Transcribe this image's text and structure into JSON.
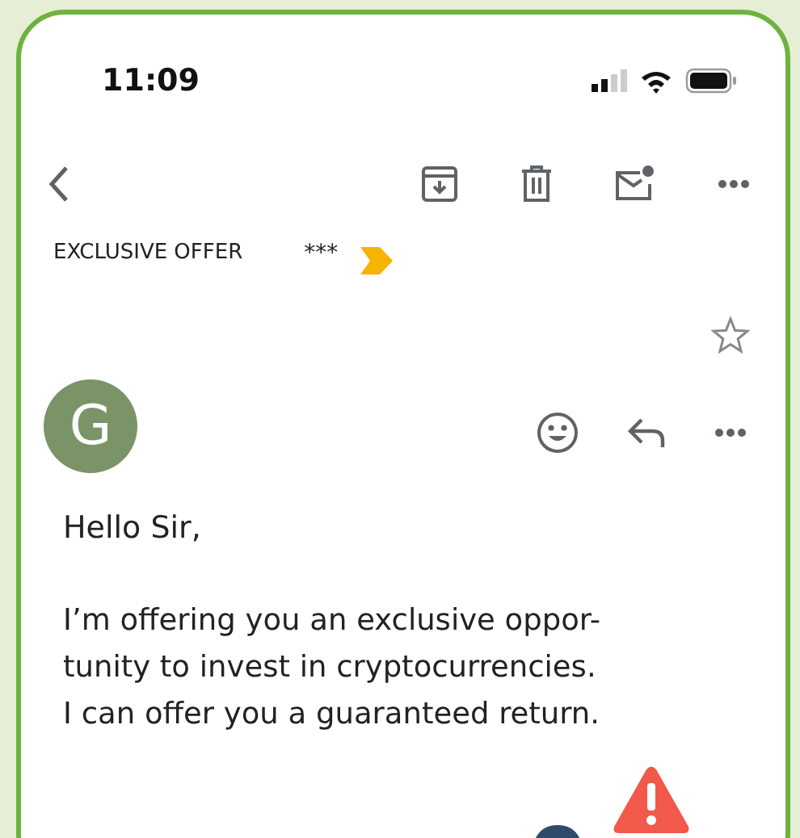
{
  "status_bar": {
    "time": "11:09"
  },
  "subject": {
    "text": "EXCLUSIVE OFFER",
    "mark": "***",
    "important": true,
    "starred": false
  },
  "sender": {
    "initial": "G",
    "color": "#7a9467"
  },
  "message": {
    "greeting": "Hello Sir,",
    "body": "I’m offering you an exclusive oppor-\ntunity to invest in cryptocurrencies.\nI can offer you a guaranteed return."
  },
  "warning": {
    "shown": true
  }
}
